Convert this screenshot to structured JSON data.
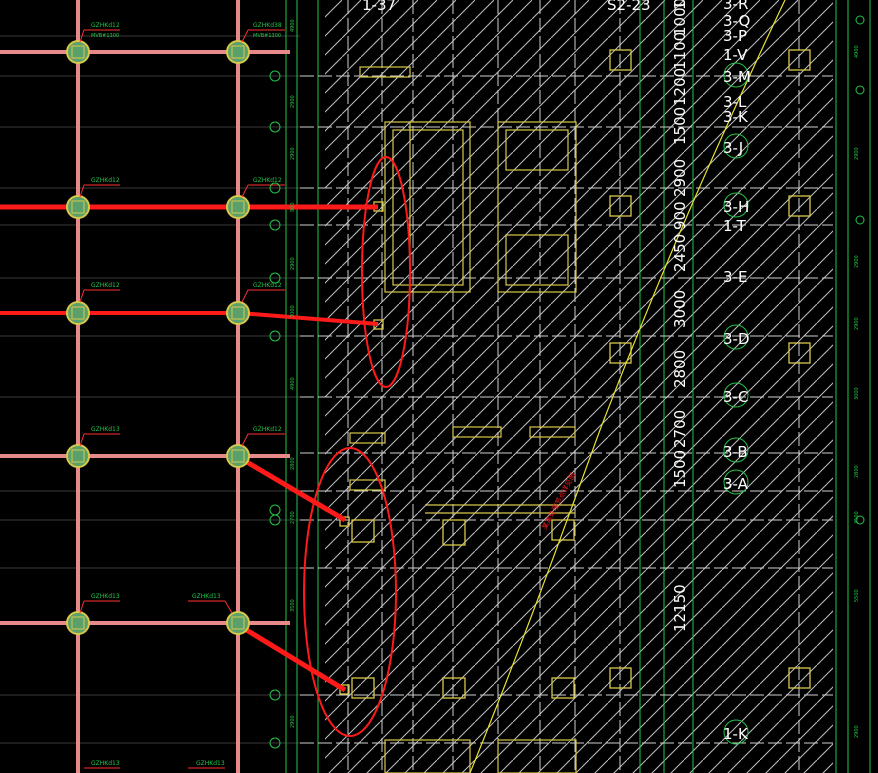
{
  "drawing": {
    "top_labels": {
      "left": "1-37",
      "right": "S2-23"
    },
    "column_tags_left": [
      "GZHKd12",
      "GZHKd12",
      "GZHKd12",
      "GZHKd13",
      "GZHKd13",
      "GZHKd13"
    ],
    "column_tags_right": [
      "GZHKd38",
      "GZHKd12",
      "GZHKd12",
      "GZHKd12",
      "GZHKd13",
      "GZHKd13"
    ],
    "column_subtags": [
      "MVB#1300",
      "MVB#1300"
    ],
    "axis_labels": [
      "3-R",
      "3-Q",
      "3-P",
      "1-V",
      "3-M",
      "3-L",
      "3-K",
      "3-J",
      "3-H",
      "1-T",
      "3-E",
      "3-D",
      "3-C",
      "3-B",
      "3-A",
      "1-K"
    ],
    "dimensions": [
      "1500",
      "2700",
      "2800",
      "3000",
      "2450",
      "900",
      "2900",
      "1500",
      "1200",
      "1100",
      "1000",
      "100",
      "12150"
    ],
    "left_dims": [
      "4900",
      "2900",
      "2900",
      "900",
      "2900",
      "3000",
      "4900",
      "2800",
      "2700",
      "3500",
      "2900"
    ],
    "right_dims": [
      "4900",
      "2900",
      "2900",
      "2900",
      "3000",
      "2800",
      "3500",
      "5500",
      "2900"
    ],
    "red_note": "某某处理节点详见图"
  }
}
